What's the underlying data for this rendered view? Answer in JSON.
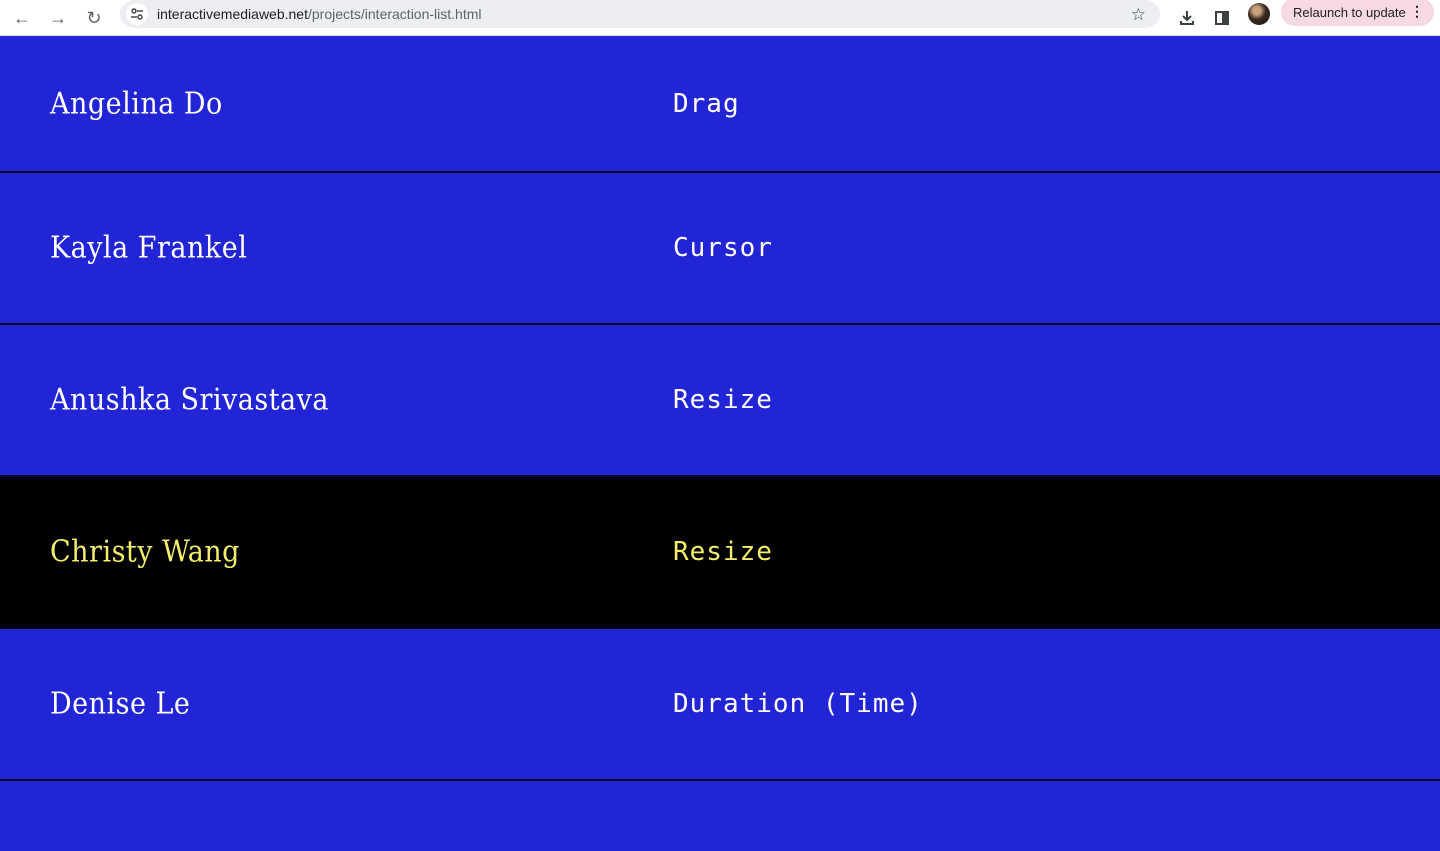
{
  "browser": {
    "url_domain": "interactivemediaweb.net",
    "url_path": "/projects/interaction-list.html",
    "relaunch_label": "Relaunch to update",
    "back_icon": "←",
    "forward_icon": "→",
    "reload_icon": "↻",
    "star_icon": "☆",
    "more_icon": "⋮"
  },
  "rows": [
    {
      "name": "Angelina Do",
      "interaction": "Drag"
    },
    {
      "name": "Kayla Frankel",
      "interaction": "Cursor"
    },
    {
      "name": "Anushka Srivastava",
      "interaction": "Resize"
    },
    {
      "name": "Christy Wang",
      "interaction": "Resize"
    },
    {
      "name": "Denise Le",
      "interaction": "Duration (Time)"
    }
  ],
  "colors": {
    "row_background": "#2225d6",
    "active_background": "#000000",
    "active_text": "#f4ef6b"
  }
}
